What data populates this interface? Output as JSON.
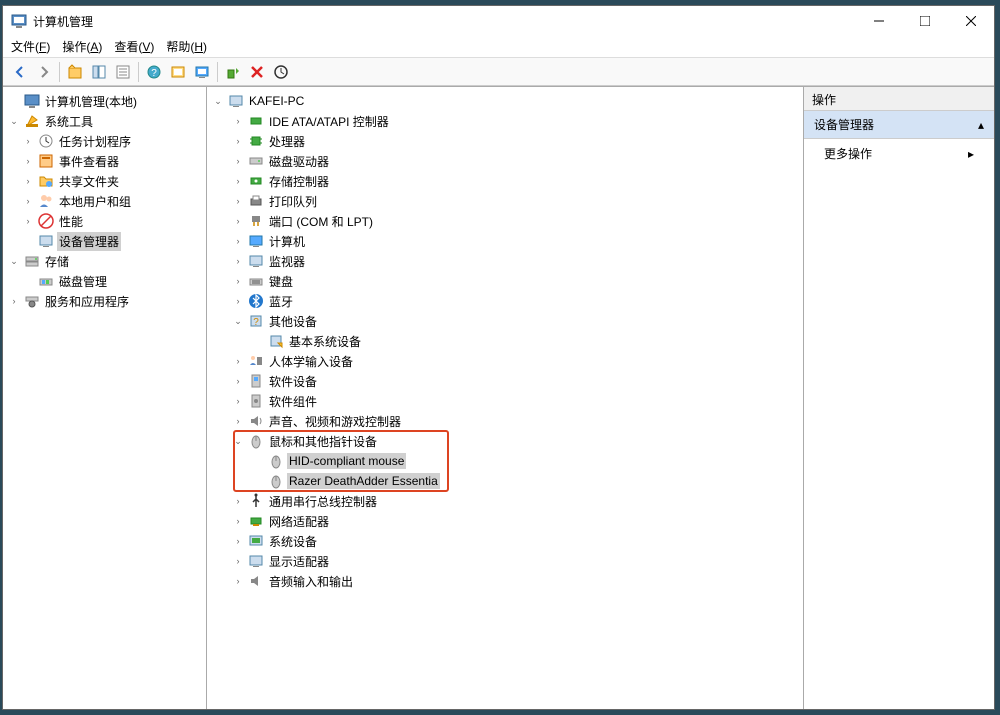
{
  "window": {
    "title": "计算机管理"
  },
  "menu": {
    "file": "文件(F)",
    "action": "操作(A)",
    "view": "查看(V)",
    "help": "帮助(H)"
  },
  "leftTree": {
    "root": "计算机管理(本地)",
    "systemTools": "系统工具",
    "taskScheduler": "任务计划程序",
    "eventViewer": "事件查看器",
    "sharedFolders": "共享文件夹",
    "localUsers": "本地用户和组",
    "performance": "性能",
    "deviceManager": "设备管理器",
    "storage": "存储",
    "diskMgmt": "磁盘管理",
    "services": "服务和应用程序"
  },
  "deviceTree": {
    "root": "KAFEI-PC",
    "ide": "IDE ATA/ATAPI 控制器",
    "cpu": "处理器",
    "diskDrives": "磁盘驱动器",
    "storageCtrl": "存储控制器",
    "printQueues": "打印队列",
    "ports": "端口 (COM 和 LPT)",
    "computer": "计算机",
    "monitors": "监视器",
    "keyboards": "键盘",
    "bluetooth": "蓝牙",
    "otherDevices": "其他设备",
    "baseSystem": "基本系统设备",
    "hid": "人体学输入设备",
    "software": "软件设备",
    "softwareComp": "软件组件",
    "sound": "声音、视频和游戏控制器",
    "mice": "鼠标和其他指针设备",
    "mouse1": "HID-compliant mouse",
    "mouse2": "Razer DeathAdder Essentia",
    "usb": "通用串行总线控制器",
    "network": "网络适配器",
    "system": "系统设备",
    "display": "显示适配器",
    "audio": "音频输入和输出"
  },
  "rightPanel": {
    "header": "操作",
    "section": "设备管理器",
    "moreActions": "更多操作"
  }
}
